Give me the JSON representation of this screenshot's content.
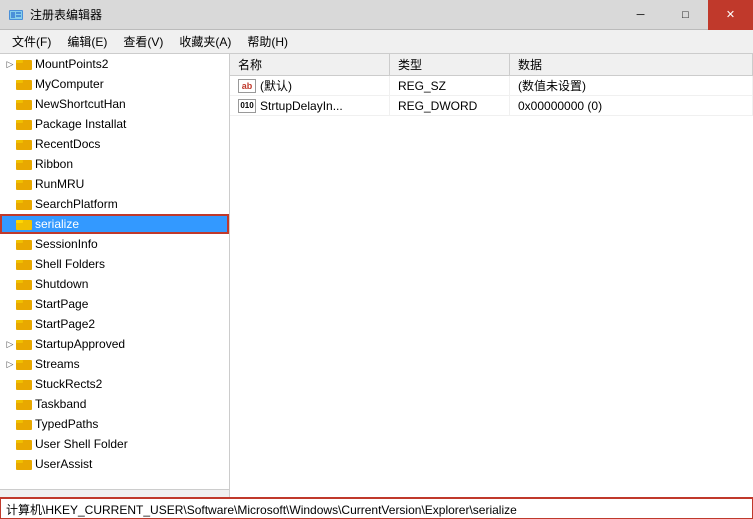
{
  "window": {
    "title": "注册表编辑器",
    "icon": "regedit-icon"
  },
  "titlebar": {
    "minimize_label": "─",
    "maximize_label": "□",
    "close_label": "✕"
  },
  "menubar": {
    "items": [
      {
        "label": "文件(F)"
      },
      {
        "label": "编辑(E)"
      },
      {
        "label": "查看(V)"
      },
      {
        "label": "收藏夹(A)"
      },
      {
        "label": "帮助(H)"
      }
    ]
  },
  "tree": {
    "items": [
      {
        "id": "MountPoints2",
        "label": "MountPoints2",
        "has_arrow": true,
        "expanded": false
      },
      {
        "id": "MyComputer",
        "label": "MyComputer",
        "has_arrow": false,
        "expanded": false
      },
      {
        "id": "NewShortcutHan",
        "label": "NewShortcutHan",
        "has_arrow": false,
        "expanded": false
      },
      {
        "id": "Package_Installat",
        "label": "Package Installat",
        "has_arrow": false,
        "expanded": false
      },
      {
        "id": "RecentDocs",
        "label": "RecentDocs",
        "has_arrow": false,
        "expanded": false
      },
      {
        "id": "Ribbon",
        "label": "Ribbon",
        "has_arrow": false,
        "expanded": false
      },
      {
        "id": "RunMRU",
        "label": "RunMRU",
        "has_arrow": false,
        "expanded": false
      },
      {
        "id": "SearchPlatform",
        "label": "SearchPlatform",
        "has_arrow": false,
        "expanded": false
      },
      {
        "id": "serialize",
        "label": "serialize",
        "has_arrow": false,
        "expanded": false,
        "selected": true
      },
      {
        "id": "SessionInfo",
        "label": "SessionInfo",
        "has_arrow": false,
        "expanded": false
      },
      {
        "id": "Shell_Folders",
        "label": "Shell Folders",
        "has_arrow": false,
        "expanded": false
      },
      {
        "id": "Shutdown",
        "label": "Shutdown",
        "has_arrow": false,
        "expanded": false
      },
      {
        "id": "StartPage",
        "label": "StartPage",
        "has_arrow": false,
        "expanded": false
      },
      {
        "id": "StartPage2",
        "label": "StartPage2",
        "has_arrow": false,
        "expanded": false
      },
      {
        "id": "StartupApproved",
        "label": "StartupApproved",
        "has_arrow": true,
        "expanded": false
      },
      {
        "id": "Streams",
        "label": "Streams",
        "has_arrow": true,
        "expanded": false
      },
      {
        "id": "StuckRects2",
        "label": "StuckRects2",
        "has_arrow": false,
        "expanded": false
      },
      {
        "id": "Taskband",
        "label": "Taskband",
        "has_arrow": false,
        "expanded": false
      },
      {
        "id": "TypedPaths",
        "label": "TypedPaths",
        "has_arrow": false,
        "expanded": false
      },
      {
        "id": "UserShellFolder",
        "label": "User Shell Folder",
        "has_arrow": false,
        "expanded": false
      },
      {
        "id": "UserAssist",
        "label": "UserAssist",
        "has_arrow": false,
        "expanded": false
      }
    ]
  },
  "detail": {
    "columns": {
      "name": "名称",
      "type": "类型",
      "data": "数据"
    },
    "rows": [
      {
        "icon": "ab",
        "name": "(默认)",
        "type": "REG_SZ",
        "data": "(数值未设置)"
      },
      {
        "icon": "bin",
        "name": "StrtupDelayIn...",
        "type": "REG_DWORD",
        "data": "0x00000000 (0)"
      }
    ]
  },
  "statusbar": {
    "path": "计算机\\HKEY_CURRENT_USER\\Software\\Microsoft\\Windows\\CurrentVersion\\Explorer\\serialize"
  },
  "colors": {
    "selected_bg": "#3399ff",
    "selected_outline": "#c0392b",
    "status_border": "#c0392b",
    "close_btn": "#c0392b"
  }
}
